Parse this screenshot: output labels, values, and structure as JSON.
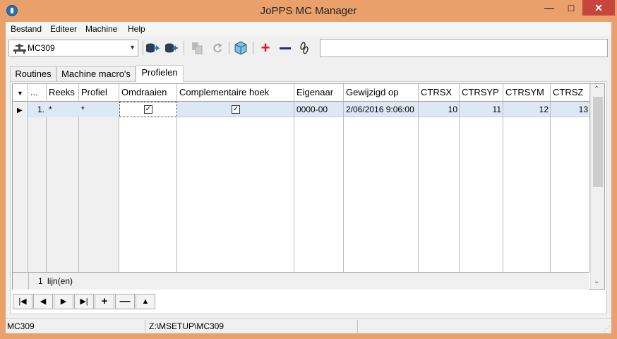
{
  "window": {
    "title": "JoPPS MC Manager"
  },
  "menu": [
    "Bestand",
    "Editeer",
    "Machine",
    "Help"
  ],
  "toolbar": {
    "machine_select_value": "MC309",
    "search_value": ""
  },
  "tabs": [
    {
      "label": "Routines",
      "active": false
    },
    {
      "label": "Machine macro's",
      "active": false
    },
    {
      "label": "Profielen",
      "active": true
    }
  ],
  "grid": {
    "columns": [
      "",
      "...",
      "Reeks",
      "Profiel",
      "Omdraaien",
      "Complementaire hoek",
      "Eigenaar",
      "Gewijzigd op",
      "CTRSX",
      "CTRSYP",
      "CTRSYM",
      "CTRSZ"
    ],
    "rows": [
      {
        "num": "1.",
        "reeks": "*",
        "profiel": "*",
        "omdraaien": true,
        "complementaire_hoek": true,
        "eigenaar": "0000-00",
        "gewijzigd_op": "2/06/2016 9:06:00",
        "ctrsx": "10",
        "ctrsyp": "11",
        "ctrsym": "12",
        "ctrsz": "13"
      }
    ],
    "footer_count": "1",
    "footer_label": "lijn(en)"
  },
  "status": {
    "left": "MC309",
    "path": "Z:\\MSETUP\\MC309"
  },
  "colors": {
    "titlebar": "#e9a06b",
    "selected_row": "#dde8f5",
    "close_button": "#c7453c"
  }
}
